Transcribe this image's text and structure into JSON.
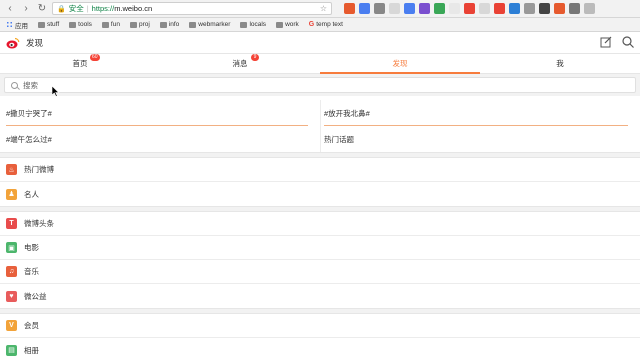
{
  "browser": {
    "secure_label": "安全",
    "url_protocol": "https://",
    "url_host": "m.weibo.cn",
    "bookmarks": [
      "应用",
      "stuff",
      "tools",
      "fun",
      "proj",
      "info",
      "webmarker",
      "locals",
      "work",
      "temp text"
    ]
  },
  "header": {
    "title": "发现"
  },
  "tabs": [
    {
      "label": "首页",
      "badge": "60"
    },
    {
      "label": "消息",
      "badge": "9"
    },
    {
      "label": "发现",
      "badge": ""
    },
    {
      "label": "我",
      "badge": ""
    }
  ],
  "search": {
    "placeholder": "搜索"
  },
  "topics": [
    "#撒贝宁哭了#",
    "#放开我北鼻#",
    "#端午怎么过#",
    "热门话题"
  ],
  "group1": [
    {
      "label": "热门微博",
      "color": "#e8603c",
      "icon": "fire-icon"
    },
    {
      "label": "名人",
      "color": "#f2a33a",
      "icon": "person-icon"
    }
  ],
  "group2": [
    {
      "label": "微博头条",
      "color": "#e84c4c",
      "icon": "headline-icon"
    },
    {
      "label": "电影",
      "color": "#4cb66c",
      "icon": "film-icon"
    },
    {
      "label": "音乐",
      "color": "#e8603c",
      "icon": "music-icon"
    },
    {
      "label": "微公益",
      "color": "#e85c5c",
      "icon": "charity-icon"
    }
  ],
  "group3": [
    {
      "label": "会员",
      "color": "#f2a33a",
      "icon": "vip-icon"
    },
    {
      "label": "相册",
      "color": "#4cb66c",
      "icon": "album-icon"
    }
  ]
}
